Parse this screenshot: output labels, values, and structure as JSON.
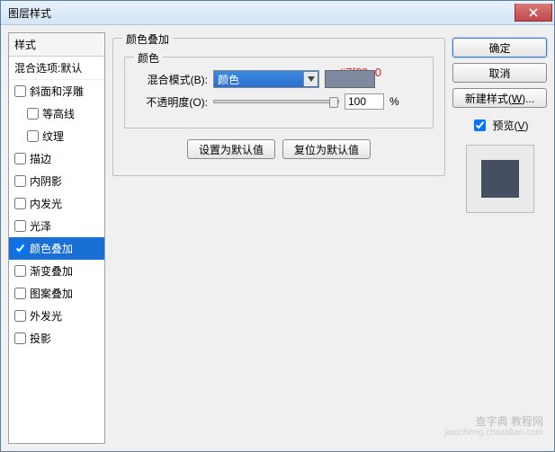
{
  "window": {
    "title": "图层样式"
  },
  "sidebar": {
    "header": "样式",
    "blend_default": "混合选项:默认",
    "items": [
      {
        "label": "斜面和浮雕",
        "checked": false,
        "indent": false,
        "selected": false
      },
      {
        "label": "等高线",
        "checked": false,
        "indent": true,
        "selected": false
      },
      {
        "label": "纹理",
        "checked": false,
        "indent": true,
        "selected": false
      },
      {
        "label": "描边",
        "checked": false,
        "indent": false,
        "selected": false
      },
      {
        "label": "内阴影",
        "checked": false,
        "indent": false,
        "selected": false
      },
      {
        "label": "内发光",
        "checked": false,
        "indent": false,
        "selected": false
      },
      {
        "label": "光泽",
        "checked": false,
        "indent": false,
        "selected": false
      },
      {
        "label": "颜色叠加",
        "checked": true,
        "indent": false,
        "selected": true
      },
      {
        "label": "渐变叠加",
        "checked": false,
        "indent": false,
        "selected": false
      },
      {
        "label": "图案叠加",
        "checked": false,
        "indent": false,
        "selected": false
      },
      {
        "label": "外发光",
        "checked": false,
        "indent": false,
        "selected": false
      },
      {
        "label": "投影",
        "checked": false,
        "indent": false,
        "selected": false
      }
    ]
  },
  "panel": {
    "group_title": "颜色叠加",
    "color_group": "颜色",
    "hex_annotation": "#7f89a0",
    "blend_label": "混合模式(B):",
    "blend_value": "颜色",
    "swatch_color": "#7f89a0",
    "opacity_label": "不透明度(O):",
    "opacity_value": "100",
    "opacity_unit": "%",
    "set_default": "设置为默认值",
    "reset_default": "复位为默认值"
  },
  "right": {
    "ok": "确定",
    "cancel": "取消",
    "new_style": "新建样式(W)...",
    "preview": "预览(V)",
    "preview_hotkey": "V",
    "new_style_hotkey": "W"
  },
  "watermark": {
    "main": "查字典 教程网",
    "sub": "jiaocheng.chazidian.com"
  }
}
